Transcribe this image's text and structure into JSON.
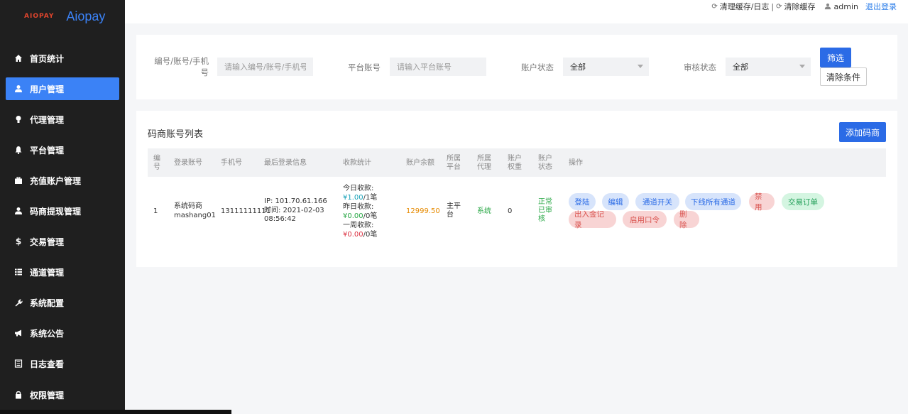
{
  "brand": {
    "logo_text": "AIOPAY",
    "name": "Aiopay"
  },
  "sidebar": {
    "items": [
      {
        "label": "首页统计",
        "icon": "home-icon",
        "active": false
      },
      {
        "label": "用户管理",
        "icon": "user-icon",
        "active": true
      },
      {
        "label": "代理管理",
        "icon": "lightbulb-icon",
        "active": false
      },
      {
        "label": "平台管理",
        "icon": "bell-icon",
        "active": false
      },
      {
        "label": "充值账户管理",
        "icon": "briefcase-icon",
        "active": false
      },
      {
        "label": "码商提现管理",
        "icon": "user-icon",
        "active": false
      },
      {
        "label": "交易管理",
        "icon": "dollar-icon",
        "active": false
      },
      {
        "label": "通道管理",
        "icon": "list-icon",
        "active": false
      },
      {
        "label": "系统配置",
        "icon": "wrench-icon",
        "active": false
      },
      {
        "label": "系统公告",
        "icon": "bullhorn-icon",
        "active": false
      },
      {
        "label": "日志查看",
        "icon": "log-icon",
        "active": false
      },
      {
        "label": "权限管理",
        "icon": "lock-icon",
        "active": false
      }
    ]
  },
  "topbar": {
    "clear_cache_log": "清理缓存/日志",
    "separator": "|",
    "clear_cache": "清除缓存",
    "username": "admin",
    "logout": "退出登录"
  },
  "filter": {
    "id_label": "编号/账号/手机号",
    "id_placeholder": "请输入编号/账号/手机号",
    "platform_label": "平台账号",
    "platform_placeholder": "请输入平台账号",
    "account_status_label": "账户状态",
    "account_status_value": "全部",
    "review_status_label": "审核状态",
    "review_status_value": "全部",
    "search_button": "筛选",
    "clear_button": "清除条件"
  },
  "list": {
    "title": "码商账号列表",
    "add_button": "添加码商",
    "columns": [
      "编号",
      "登录账号",
      "手机号",
      "最后登录信息",
      "收款统计",
      "账户余额",
      "所属平台",
      "所属代理",
      "账户权重",
      "账户状态",
      "操作"
    ],
    "rows": [
      {
        "id": "1",
        "login_name": "系统码商",
        "login_account": "mashang01",
        "phone": "13111111111",
        "ip": "IP: 101.70.61.166",
        "time": "时间: 2021-02-03 08:56:42",
        "today_label": "今日收款:",
        "today_amount": "¥1.00",
        "today_count": "/1笔",
        "yesterday_label": "昨日收款:",
        "yesterday_amount": "¥0.00",
        "yesterday_count": "/0笔",
        "week_label": "一周收款:",
        "week_amount": "¥0.00",
        "week_count": "/0笔",
        "balance": "12999.50",
        "platform": "主平台",
        "agent": "系统",
        "weight": "0",
        "status": "正常",
        "review": "已审核",
        "actions": {
          "login": "登陆",
          "edit": "编辑",
          "channel_switch": "通道开关",
          "offline_channels": "下线所有通道",
          "disable": "禁用",
          "trade_orders": "交易订单",
          "fund_records": "出入金记录",
          "enable_password": "启用口令",
          "delete": "删除"
        }
      }
    ]
  }
}
